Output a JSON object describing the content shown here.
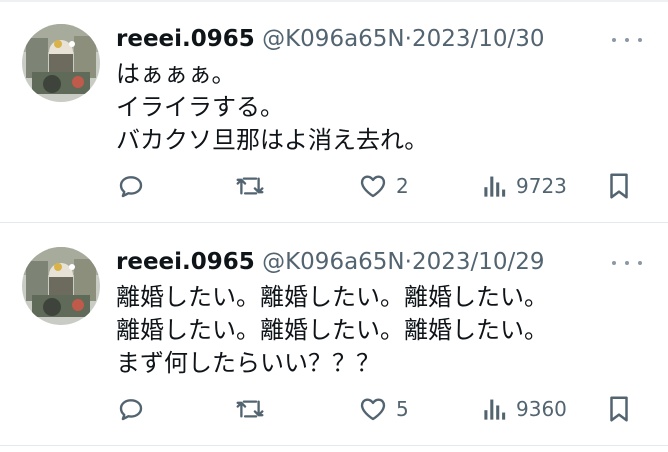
{
  "tweets": [
    {
      "name": "reeei.0965",
      "handle": "@K096a65N",
      "dot": "·",
      "date": "2023/10/30",
      "lines": [
        "はぁぁぁ。",
        "イライラする。",
        "バカクソ旦那はよ消え去れ。"
      ],
      "likes": "2",
      "views": "9723"
    },
    {
      "name": "reeei.0965",
      "handle": "@K096a65N",
      "dot": "·",
      "date": "2023/10/29",
      "lines": [
        "離婚したい。離婚したい。離婚したい。",
        "離婚したい。離婚したい。離婚したい。",
        "まず何したらいい？？？"
      ],
      "likes": "5",
      "views": "9360"
    }
  ],
  "icons": {
    "reply": "reply-icon",
    "retweet": "retweet-icon",
    "like": "heart-icon",
    "views": "views-chart-icon",
    "bookmark": "bookmark-icon",
    "more": "more-dots-icon"
  },
  "colors": {
    "text": "#0f1419",
    "secondary": "#536471",
    "separator": "#e6e9ec"
  }
}
